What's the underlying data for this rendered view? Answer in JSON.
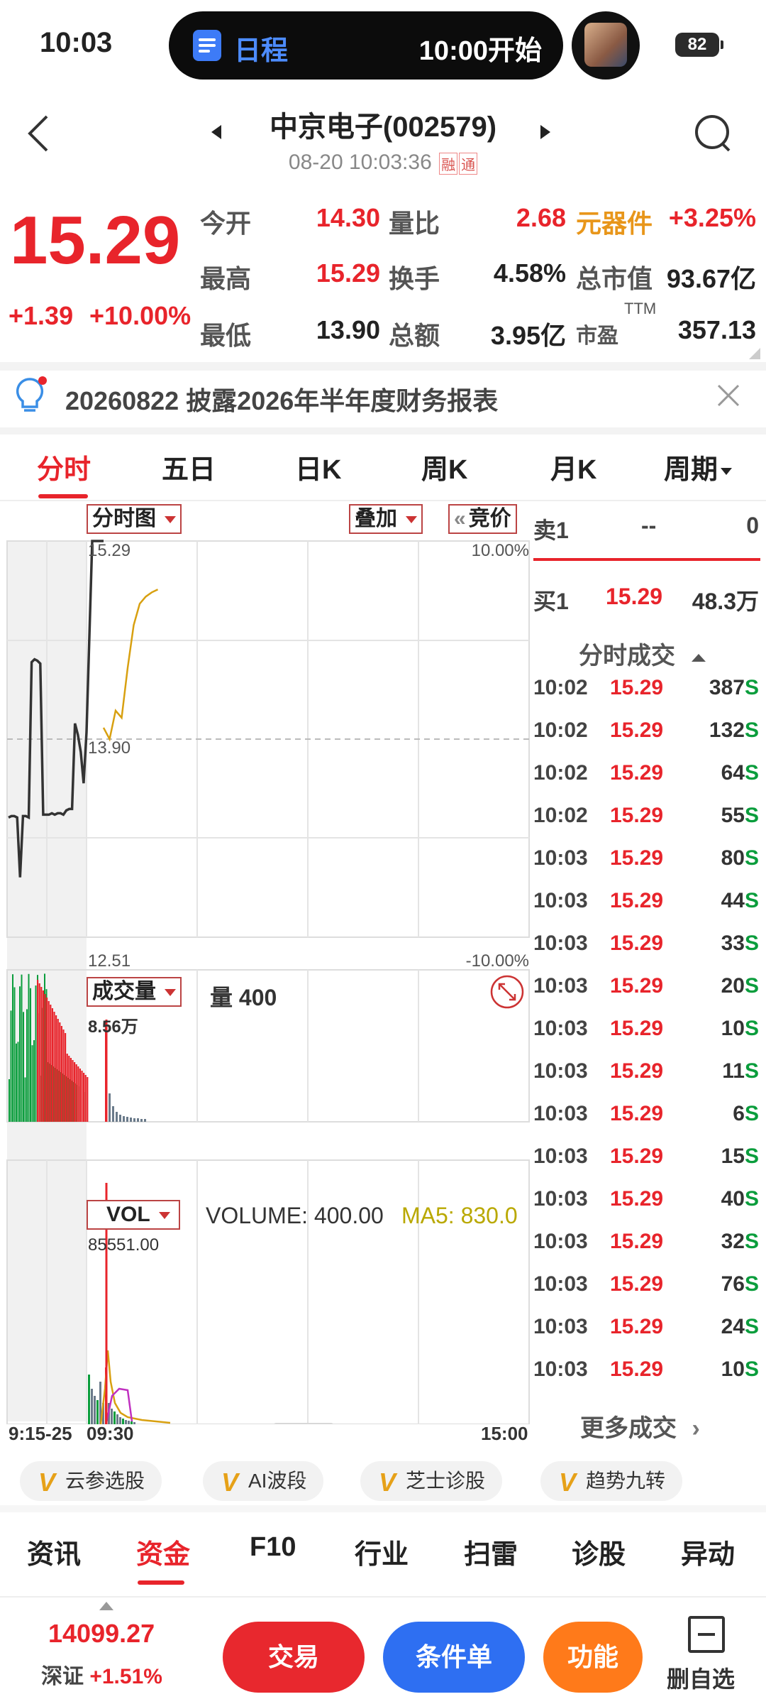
{
  "status_bar": {
    "time": "10:03",
    "pill_label": "日程",
    "pill_time": "10:00开始",
    "battery": "82"
  },
  "header": {
    "title": "中京电子(002579)",
    "subtitle": "08-20 10:03:36",
    "badge_rong": "融",
    "badge_tong": "通"
  },
  "quote": {
    "price": "15.29",
    "change": "+1.39",
    "change_pct": "+10.00%",
    "rows": [
      {
        "l1": "今开",
        "v1": "14.30",
        "l2": "量比",
        "v2": "2.68",
        "l3": "元器件",
        "v3": "+3.25%"
      },
      {
        "l1": "最高",
        "v1": "15.29",
        "l2": "换手",
        "v2": "4.58%",
        "l3": "总市值",
        "v3": "93.67亿"
      },
      {
        "l1": "最低",
        "v1": "13.90",
        "l2": "总额",
        "v2": "3.95亿",
        "l3": "市盈",
        "l3sup": "TTM",
        "v3": "357.13"
      }
    ]
  },
  "notice": {
    "text": "20260822 披露2026年半年度财务报表"
  },
  "chart_tabs": [
    "分时",
    "五日",
    "日K",
    "周K",
    "月K",
    "周期"
  ],
  "chart": {
    "main_selector": "分时图",
    "overlay_selector": "叠加",
    "auction_button": "竞价",
    "price_max": "15.29",
    "price_mid": "13.90",
    "price_min": "12.51",
    "pct_max": "10.00%",
    "pct_min": "-10.00%",
    "vol_selector": "成交量",
    "vol_text": "量 400",
    "vol_max": "8.56万",
    "ind_selector": "VOL",
    "ind_volume": "VOLUME: 400.00",
    "ind_ma5": "MA5: 830.0",
    "ind_max": "85551.00",
    "time_start": "9:15-25",
    "time_open": "09:30",
    "time_end": "15:00"
  },
  "chart_data": {
    "type": "line",
    "title": "",
    "series": [
      {
        "values": [
          13.35,
          13.36,
          13.36,
          13.35,
          12.93,
          13.36,
          13.36,
          13.35,
          14.44,
          14.46,
          14.45,
          14.43,
          13.37,
          13.37,
          13.37,
          13.38,
          13.37,
          13.38,
          13.38,
          13.37,
          13.4,
          13.41,
          13.41,
          14.01,
          13.93,
          13.81,
          13.59,
          13.95,
          15.29,
          15.29,
          15.29
        ]
      },
      {
        "values": [
          13.98,
          13.9,
          14.1,
          14.05,
          14.4,
          14.7,
          14.85,
          14.9,
          14.93,
          14.95
        ]
      }
    ],
    "ylim": [
      12.51,
      15.29
    ]
  },
  "order_book": {
    "sell1_label": "卖1",
    "sell1_price": "--",
    "sell1_vol": "0",
    "buy1_label": "买1",
    "buy1_price": "15.29",
    "buy1_vol": "48.3万",
    "ticks_title": "分时成交",
    "ticks": [
      {
        "t": "10:02",
        "p": "15.29",
        "v": "387",
        "s": "S"
      },
      {
        "t": "10:02",
        "p": "15.29",
        "v": "132",
        "s": "S"
      },
      {
        "t": "10:02",
        "p": "15.29",
        "v": "64",
        "s": "S"
      },
      {
        "t": "10:02",
        "p": "15.29",
        "v": "55",
        "s": "S"
      },
      {
        "t": "10:03",
        "p": "15.29",
        "v": "80",
        "s": "S"
      },
      {
        "t": "10:03",
        "p": "15.29",
        "v": "44",
        "s": "S"
      },
      {
        "t": "10:03",
        "p": "15.29",
        "v": "33",
        "s": "S"
      },
      {
        "t": "10:03",
        "p": "15.29",
        "v": "20",
        "s": "S"
      },
      {
        "t": "10:03",
        "p": "15.29",
        "v": "10",
        "s": "S"
      },
      {
        "t": "10:03",
        "p": "15.29",
        "v": "11",
        "s": "S"
      },
      {
        "t": "10:03",
        "p": "15.29",
        "v": "6",
        "s": "S"
      },
      {
        "t": "10:03",
        "p": "15.29",
        "v": "15",
        "s": "S"
      },
      {
        "t": "10:03",
        "p": "15.29",
        "v": "40",
        "s": "S"
      },
      {
        "t": "10:03",
        "p": "15.29",
        "v": "32",
        "s": "S"
      },
      {
        "t": "10:03",
        "p": "15.29",
        "v": "76",
        "s": "S"
      },
      {
        "t": "10:03",
        "p": "15.29",
        "v": "24",
        "s": "S"
      },
      {
        "t": "10:03",
        "p": "15.29",
        "v": "10",
        "s": "S"
      }
    ],
    "more": "更多成交"
  },
  "features": [
    "云参选股",
    "AI波段",
    "芝士诊股",
    "趋势九转"
  ],
  "bottom_tabs": [
    "资讯",
    "资金",
    "F10",
    "行业",
    "扫雷",
    "诊股",
    "异动"
  ],
  "footer": {
    "index_value": "14099.27",
    "index_name": "深证",
    "index_pct": "+1.51%",
    "trade_button": "交易",
    "condition_button": "条件单",
    "function_button": "功能",
    "remove_watch": "删自选"
  },
  "colors": {
    "up": "#e8242b",
    "down": "#0a9d3c",
    "avg_line": "#d8a010",
    "trade_btn": "#e8282e",
    "condition_btn": "#2e6ff2",
    "function_btn": "#ff7a1a"
  }
}
